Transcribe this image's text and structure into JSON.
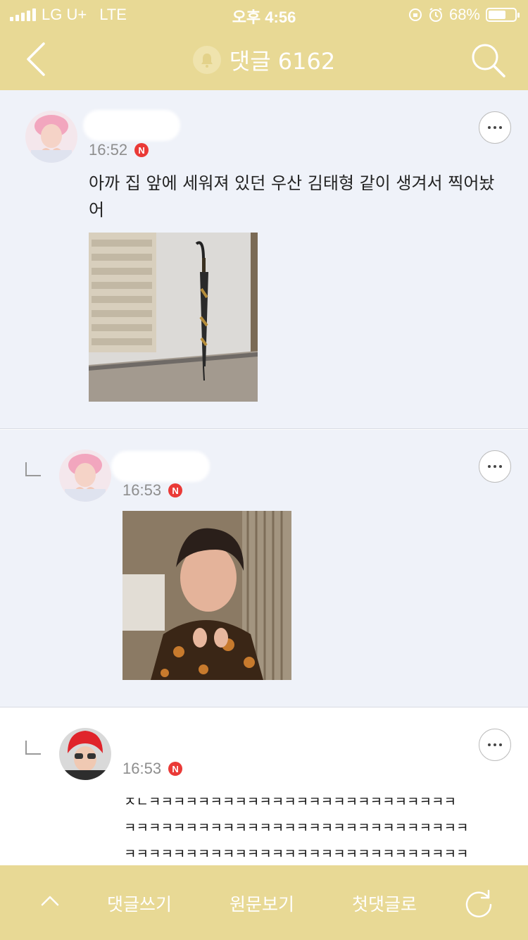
{
  "status_bar": {
    "carrier": "LG U+",
    "network": "LTE",
    "time": "오후 4:56",
    "battery": "68%",
    "battery_level": 0.68
  },
  "header": {
    "title": "댓글 6162",
    "back_icon": "chevron-left-icon",
    "bell_icon": "bell-icon",
    "search_icon": "search-icon"
  },
  "comments": [
    {
      "time": "16:52",
      "badge": "N",
      "text": "아까 집 앞에 세워져 있던 우산 김태형 같이 생겨서 찍어놨어"
    },
    {
      "time": "16:53",
      "badge": "N"
    },
    {
      "time": "16:53",
      "badge": "N",
      "lines": [
        "ㅈㄴㅋㅋㅋㅋㅋㅋㅋㅋㅋㅋㅋㅋㅋㅋㅋㅋㅋㅋㅋㅋㅋㅋㅋㅋㅋ",
        "ㅋㅋㅋㅋㅋㅋㅋㅋㅋㅋㅋㅋㅋㅋㅋㅋㅋㅋㅋㅋㅋㅋㅋㅋㅋㅋㅋㅋ",
        "ㅋㅋㅋㅋㅋㅋㅋㅋㅋㅋㅋㅋㅋㅋㅋㅋㅋㅋㅋㅋㅋㅋㅋㅋㅋㅋㅋㅋ"
      ]
    }
  ],
  "bottom_bar": {
    "write": "댓글쓰기",
    "view_original": "원문보기",
    "to_first": "첫댓글로"
  },
  "colors": {
    "bar": "#e8d995",
    "comment_bg": "#eff2f9",
    "badge": "#ea3a37"
  }
}
